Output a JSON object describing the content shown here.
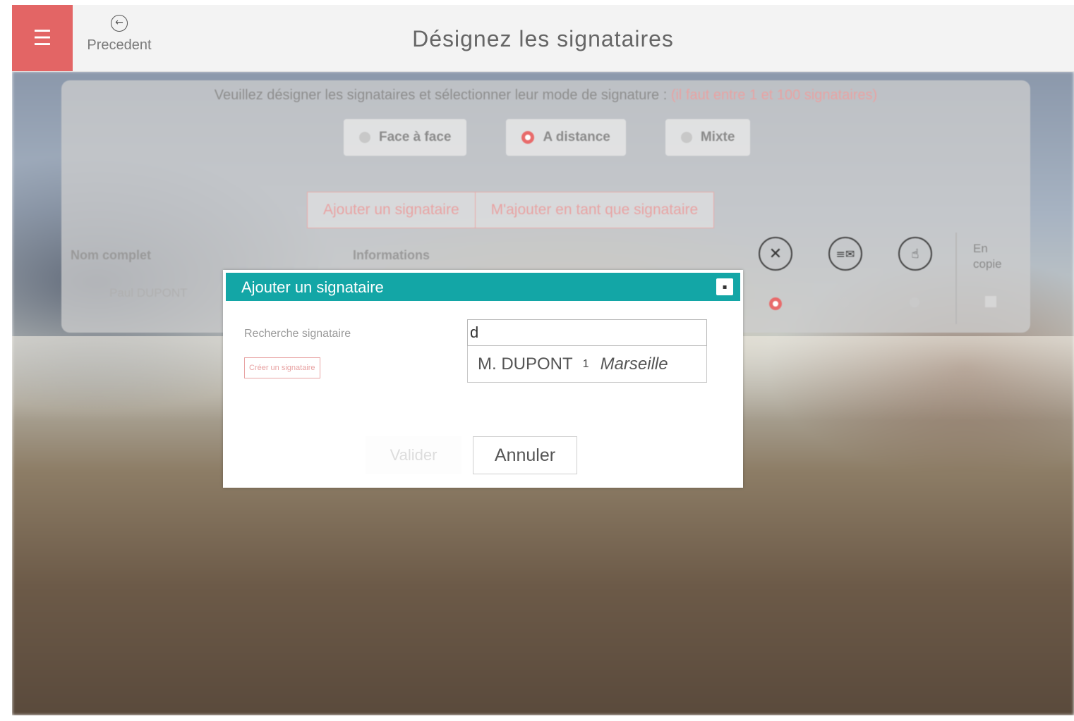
{
  "header": {
    "menu_icon": "hamburger-icon",
    "back_label": "Precedent",
    "title": "Désignez les signataires"
  },
  "panel": {
    "instruction": "Veuillez désigner les signataires et sélectionner leur mode de signature :",
    "instruction_highlight": "(il faut entre 1 et 100 signataires)",
    "modes": [
      {
        "label": "Face à face",
        "selected": false
      },
      {
        "label": "A distance",
        "selected": true
      },
      {
        "label": "Mixte",
        "selected": false
      }
    ],
    "add_signer_label": "Ajouter un signataire",
    "add_me_label": "M'ajouter en tant que signataire",
    "columns": {
      "name": "Nom complet",
      "info": "Informations",
      "en_copie": "En copie"
    },
    "column_icons": [
      "close-circle-icon",
      "list-mail-icon",
      "hand-touch-icon"
    ],
    "rows": [
      {
        "name": "Paul DUPONT"
      }
    ]
  },
  "modal": {
    "title": "Ajouter un signataire",
    "search_label": "Recherche signataire",
    "create_label": "Créer un signataire",
    "search_value": "d",
    "suggestion": {
      "name": "M. DUPONT",
      "separator": "1",
      "city": "Marseille"
    },
    "valider_label": "Valider",
    "annuler_label": "Annuler"
  },
  "colors": {
    "accent_red": "#e36565",
    "modal_header": "#13a6a6"
  }
}
